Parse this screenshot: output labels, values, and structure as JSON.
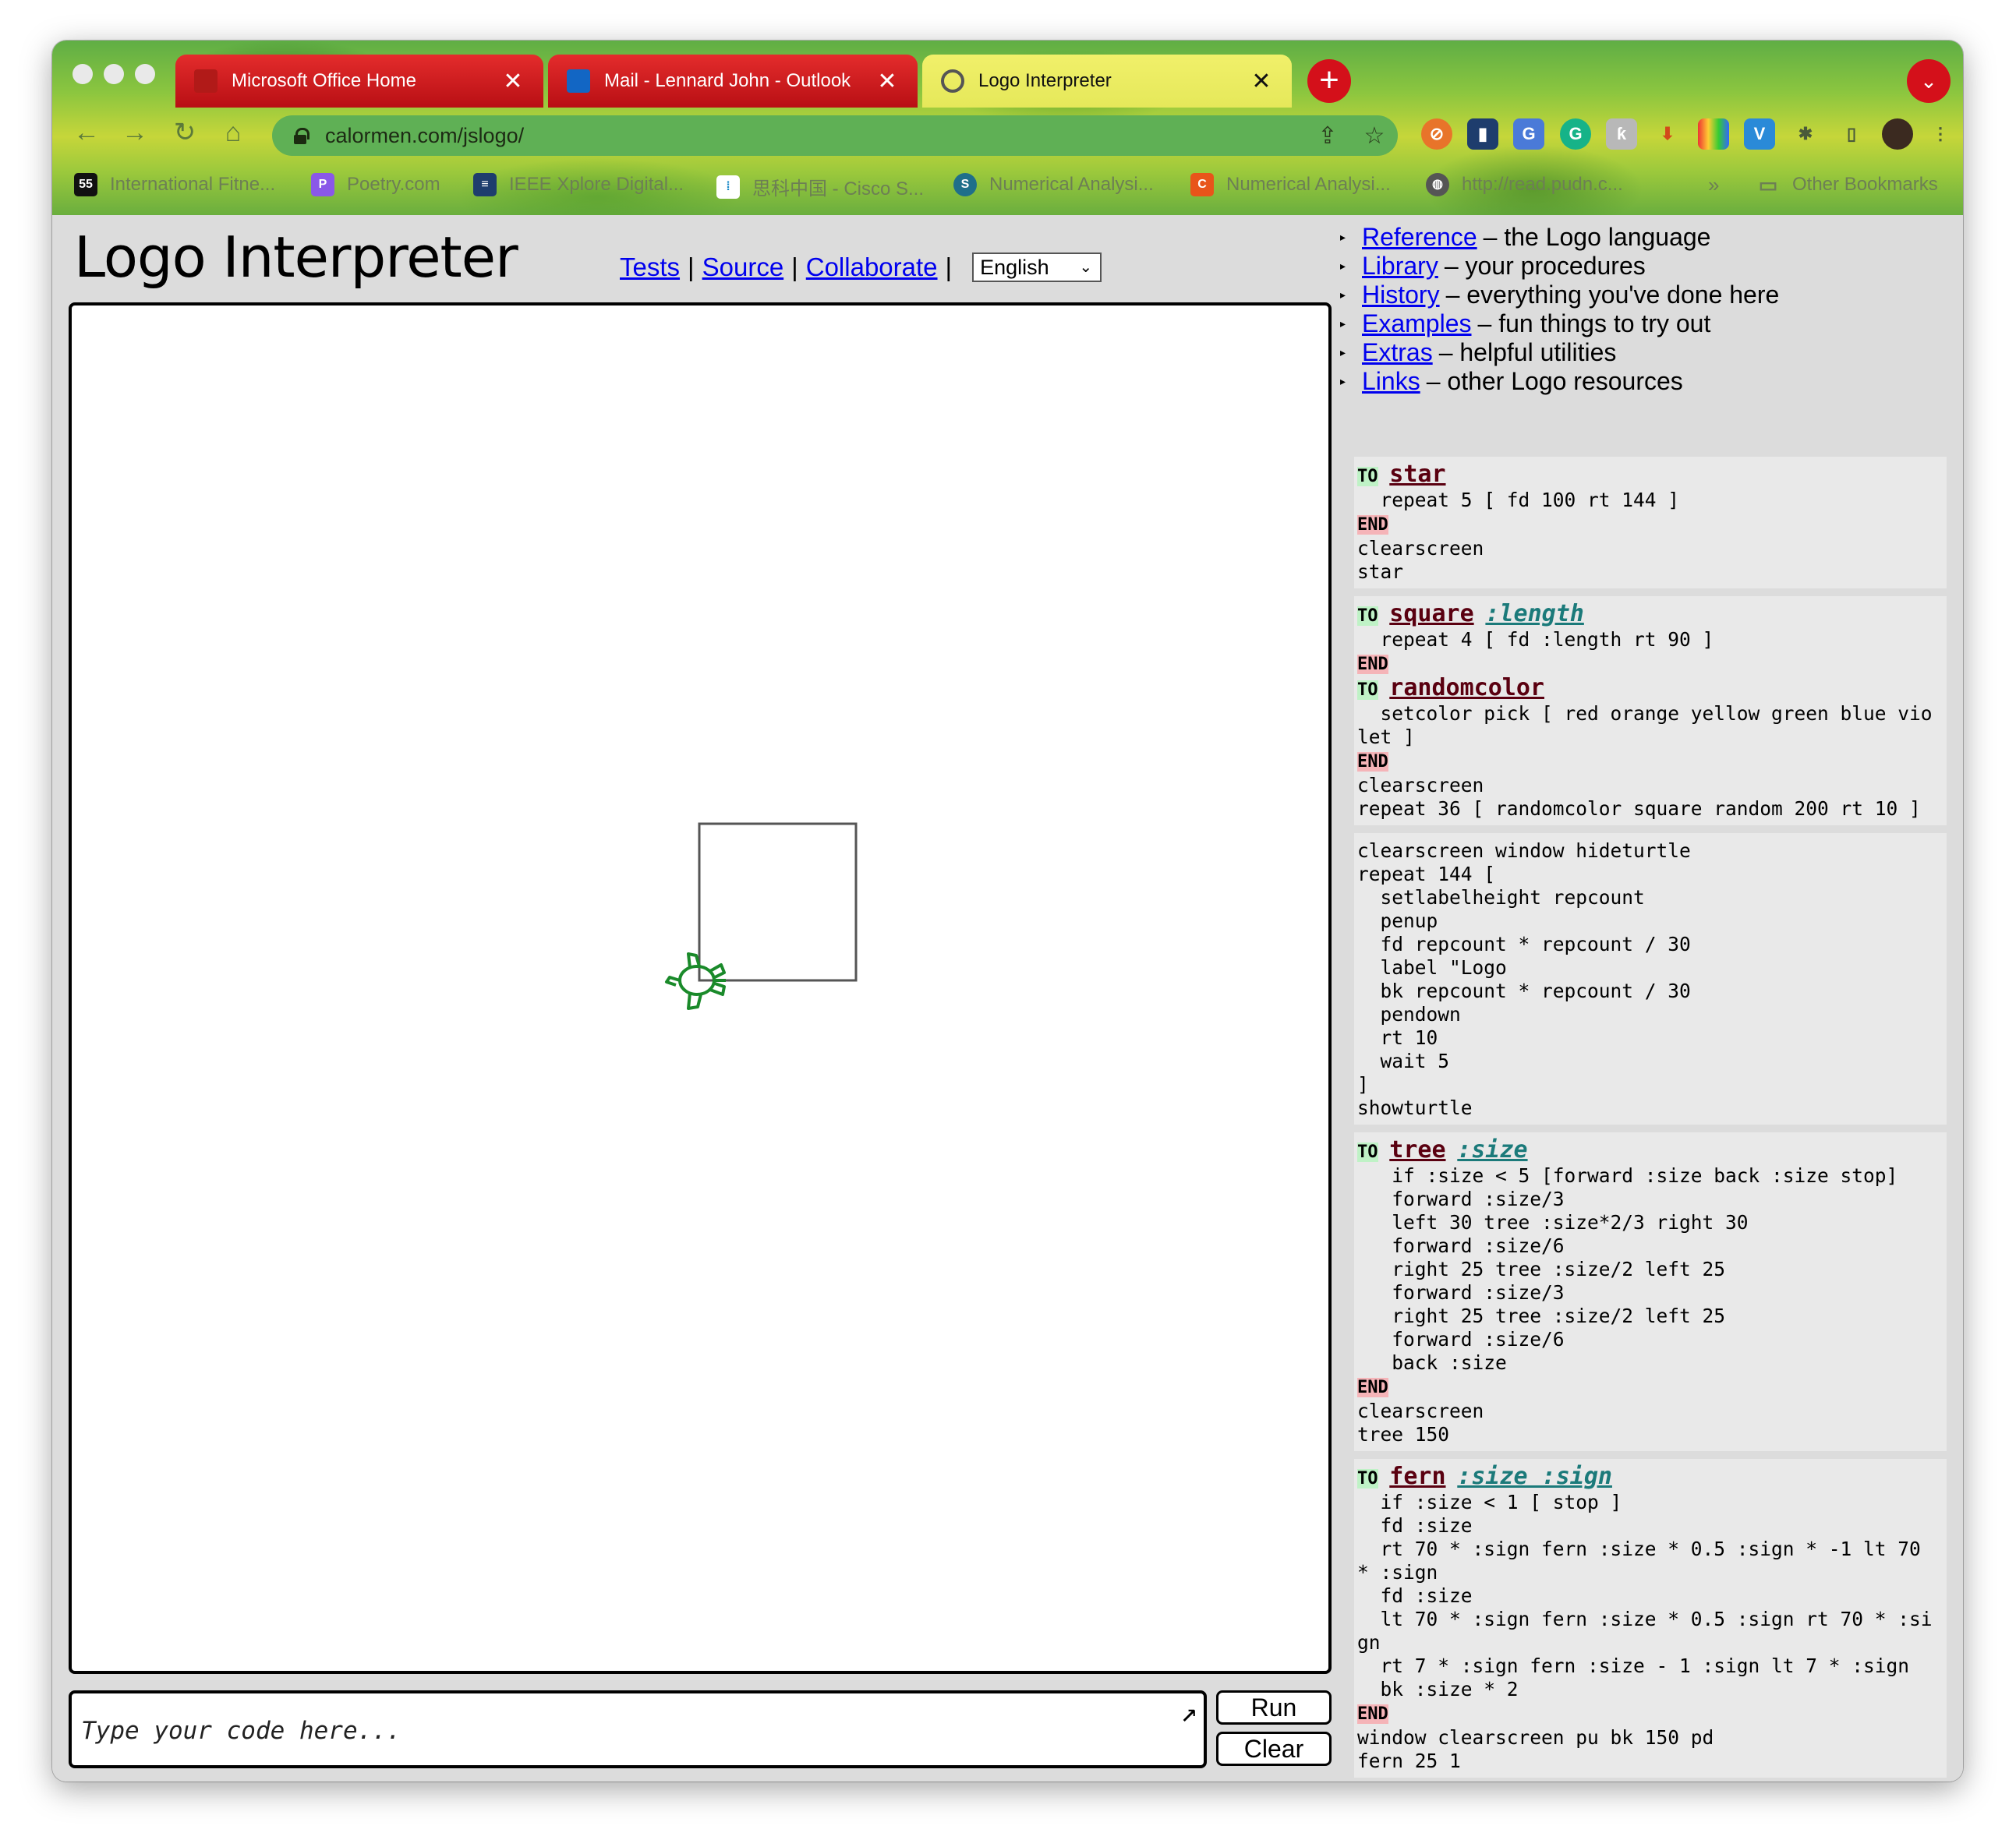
{
  "browser": {
    "tabs": [
      {
        "title": "Microsoft Office Home",
        "close": "✕"
      },
      {
        "title": "Mail - Lennard John - Outlook",
        "close": "✕"
      },
      {
        "title": "Logo Interpreter",
        "close": "✕"
      }
    ],
    "new_tab": "+",
    "url": "calormen.com/jslogo/",
    "bookmarks": [
      {
        "label": "International Fitne..."
      },
      {
        "label": "Poetry.com"
      },
      {
        "label": "IEEE Xplore Digital..."
      },
      {
        "label": "思科中国 - Cisco S..."
      },
      {
        "label": "Numerical Analysi..."
      },
      {
        "label": "Numerical Analysi..."
      },
      {
        "label": "http://read.pudn.c..."
      }
    ],
    "bookmarks_overflow": "»",
    "other_bookmarks": "Other Bookmarks"
  },
  "page": {
    "title": "Logo Interpreter",
    "links": {
      "tests": "Tests",
      "source": "Source",
      "collaborate": "Collaborate",
      "separator": "|"
    },
    "language": "English",
    "input_placeholder": "Type your code here...",
    "run_label": "Run",
    "clear_label": "Clear",
    "menu": [
      {
        "link": "Reference",
        "desc": "– the Logo language"
      },
      {
        "link": "Library",
        "desc": "– your procedures"
      },
      {
        "link": "History",
        "desc": "– everything you've done here"
      },
      {
        "link": "Examples",
        "desc": "– fun things to try out"
      },
      {
        "link": "Extras",
        "desc": "– helpful utilities"
      },
      {
        "link": "Links",
        "desc": "– other Logo resources"
      }
    ],
    "examples": {
      "star": {
        "to": "TO",
        "name": "star",
        "body": "  repeat 5 [ fd 100 rt 144 ]",
        "end": "END",
        "after": "clearscreen\nstar"
      },
      "square": {
        "to": "TO",
        "name": "square",
        "param": ":length",
        "body": "  repeat 4 [ fd :length rt 90 ]",
        "end": "END"
      },
      "randomcolor": {
        "to": "TO",
        "name": "randomcolor",
        "body": "  setcolor pick [ red orange yellow green blue violet ]",
        "end": "END",
        "after": "clearscreen\nrepeat 36 [ randomcolor square random 200 rt 10 ]"
      },
      "labels": "clearscreen window hideturtle\nrepeat 144 [\n  setlabelheight repcount\n  penup\n  fd repcount * repcount / 30\n  label \"Logo\n  bk repcount * repcount / 30\n  pendown\n  rt 10\n  wait 5\n]\nshowturtle",
      "tree": {
        "to": "TO",
        "name": "tree",
        "param": ":size",
        "body": "   if :size < 5 [forward :size back :size stop]\n   forward :size/3\n   left 30 tree :size*2/3 right 30\n   forward :size/6\n   right 25 tree :size/2 left 25\n   forward :size/3\n   right 25 tree :size/2 left 25\n   forward :size/6\n   back :size",
        "end": "END",
        "after": "clearscreen\ntree 150"
      },
      "fern": {
        "to": "TO",
        "name": "fern",
        "params": ":size :sign",
        "body": "  if :size < 1 [ stop ]\n  fd :size\n  rt 70 * :sign fern :size * 0.5 :sign * -1 lt 70 * :sign\n  fd :size\n  lt 70 * :sign fern :size * 0.5 :sign rt 70 * :sign\n  rt 7 * :sign fern :size - 1 :sign lt 7 * :sign\n  bk :size * 2",
        "end": "END",
        "after": "window clearscreen pu bk 150 pd\nfern 25 1"
      }
    }
  },
  "colors": {
    "turtle": "#1a8a2a",
    "square_stroke": "#555555",
    "link": "#0000ee"
  }
}
